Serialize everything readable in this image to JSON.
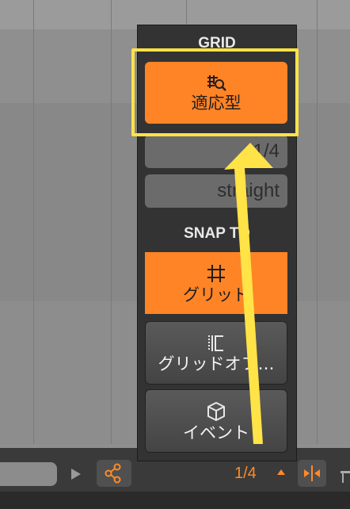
{
  "popup": {
    "grid_title": "GRID",
    "adaptive_label": "適応型",
    "grid_rate": "1/4",
    "grid_type": "straight",
    "snap_title": "SNAP TO",
    "snap_grid_label": "グリッド",
    "snap_grid_offset_label": "グリッドオフ…",
    "snap_events_label": "イベント"
  },
  "transport": {
    "grid_value": "1/4"
  },
  "colors": {
    "accent": "#ff8426",
    "highlight": "#ffe347"
  },
  "icons": [
    "adaptive-grid-icon",
    "grid-icon",
    "grid-offset-icon",
    "cube-icon",
    "play-icon",
    "nodes-icon",
    "split-icon"
  ]
}
